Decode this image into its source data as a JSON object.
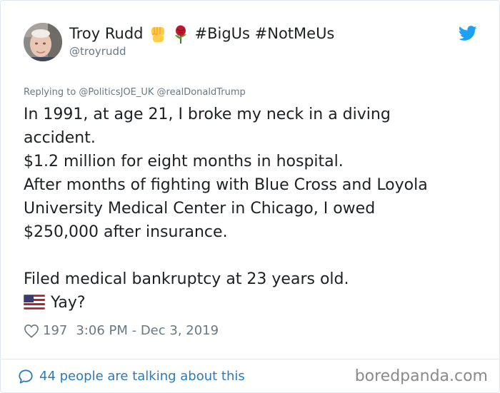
{
  "author": {
    "display_name": "Troy Rudd",
    "hashtags": "#BigUs #NotMeUs",
    "handle": "@troyrudd",
    "name_emojis": [
      "raised-fist-emoji",
      "rose-emoji"
    ]
  },
  "replying_to": "Replying to @PoliticsJOE_UK @realDonaldTrump",
  "tweet": {
    "lines": [
      "In 1991, at age 21, I broke my neck in a diving",
      "accident.",
      "$1.2 million for eight months in hospital.",
      "After months of fighting with Blue Cross and Loyola",
      "University Medical Center in Chicago, I owed",
      "$250,000 after insurance.",
      "",
      "Filed medical bankruptcy at 23 years old."
    ],
    "last_line_emoji": "us-flag-emoji",
    "last_line_text": "Yay?"
  },
  "meta": {
    "likes": "197",
    "timestamp": "3:06 PM - Dec 3, 2019"
  },
  "footer": {
    "talking": "44 people are talking about this",
    "watermark": "boredpanda.com"
  },
  "colors": {
    "link_blue": "#2b7bb9",
    "twitter_blue": "#1da1f2",
    "muted_gray": "#697882",
    "text": "#1c2022"
  },
  "icons": [
    "twitter-bird-icon",
    "heart-icon",
    "speech-bubble-icon"
  ]
}
